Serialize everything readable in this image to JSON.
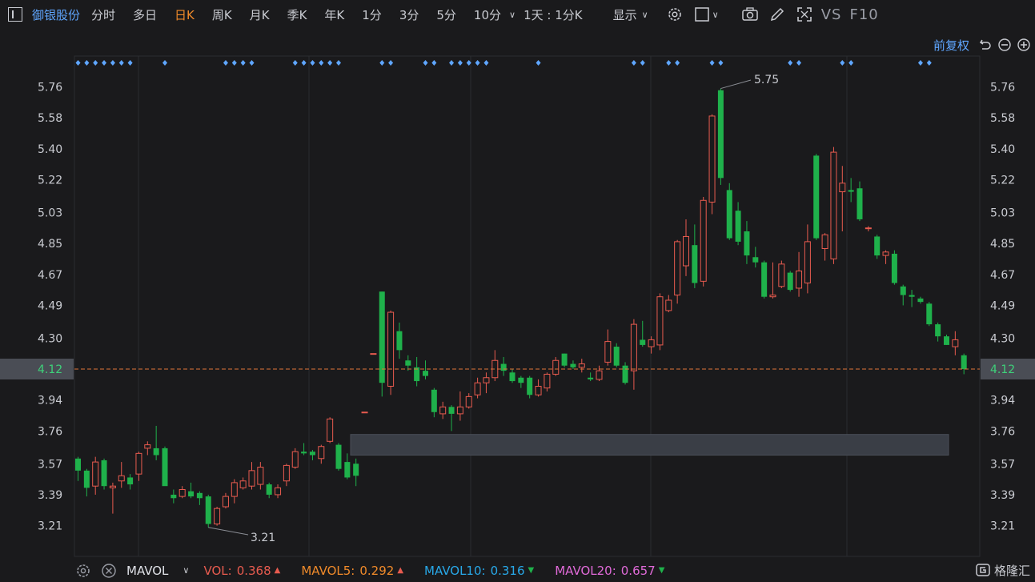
{
  "toolbar": {
    "stock_name": "御银股份",
    "tabs": [
      "分时",
      "多日",
      "日K",
      "周K",
      "月K",
      "季K",
      "年K",
      "1分",
      "3分",
      "5分",
      "10分"
    ],
    "active_tab": "日K",
    "minute_setting": "1天 : 1分K",
    "display_label": "显示",
    "vs_label": "VS",
    "f10_label": "F10"
  },
  "sub_toolbar": {
    "adjust_label": "前复权"
  },
  "bottom": {
    "indicator": "MAVOL",
    "vol_label": "VOL:",
    "vol_value": "0.368",
    "mavol5_label": "MAVOL5:",
    "mavol5_value": "0.292",
    "mavol10_label": "MAVOL10:",
    "mavol10_value": "0.316",
    "mavol20_label": "MAVOL20:",
    "mavol20_value": "0.657",
    "logo": "格隆汇"
  },
  "colors": {
    "up": "#e85b4f",
    "down": "#1fb14b",
    "accent": "#5fa6ff",
    "active_tab": "#f08a2a",
    "mavol5": "#f08a2a",
    "mavol10": "#28a8e8",
    "mavol20": "#e06ad8"
  },
  "chart_data": {
    "type": "candlestick",
    "y_ticks": [
      "5.76",
      "5.58",
      "5.40",
      "5.22",
      "5.03",
      "4.85",
      "4.67",
      "4.49",
      "4.30",
      "4.12",
      "3.94",
      "3.76",
      "3.57",
      "3.39",
      "3.21"
    ],
    "current_price": "4.12",
    "high_label": "5.75",
    "low_label": "3.21",
    "annotation_box": {
      "y_low": 3.62,
      "y_high": 3.74
    },
    "candles": [
      {
        "o": 3.6,
        "h": 3.61,
        "l": 3.47,
        "c": 3.53
      },
      {
        "o": 3.53,
        "h": 3.54,
        "l": 3.38,
        "c": 3.43
      },
      {
        "o": 3.44,
        "h": 3.61,
        "l": 3.39,
        "c": 3.58
      },
      {
        "o": 3.59,
        "h": 3.6,
        "l": 3.42,
        "c": 3.44
      },
      {
        "o": 3.43,
        "h": 3.46,
        "l": 3.28,
        "c": 3.44
      },
      {
        "o": 3.47,
        "h": 3.58,
        "l": 3.43,
        "c": 3.5
      },
      {
        "o": 3.49,
        "h": 3.51,
        "l": 3.42,
        "c": 3.45
      },
      {
        "o": 3.51,
        "h": 3.64,
        "l": 3.47,
        "c": 3.63
      },
      {
        "o": 3.66,
        "h": 3.7,
        "l": 3.62,
        "c": 3.68
      },
      {
        "o": 3.66,
        "h": 3.79,
        "l": 3.59,
        "c": 3.62
      },
      {
        "o": 3.66,
        "h": 3.67,
        "l": 3.45,
        "c": 3.44
      },
      {
        "o": 3.39,
        "h": 3.42,
        "l": 3.34,
        "c": 3.37
      },
      {
        "o": 3.38,
        "h": 3.44,
        "l": 3.37,
        "c": 3.42
      },
      {
        "o": 3.41,
        "h": 3.46,
        "l": 3.37,
        "c": 3.38
      },
      {
        "o": 3.4,
        "h": 3.41,
        "l": 3.33,
        "c": 3.37
      },
      {
        "o": 3.38,
        "h": 3.39,
        "l": 3.2,
        "c": 3.22
      },
      {
        "o": 3.22,
        "h": 3.32,
        "l": 3.21,
        "c": 3.31
      },
      {
        "o": 3.32,
        "h": 3.4,
        "l": 3.31,
        "c": 3.38
      },
      {
        "o": 3.38,
        "h": 3.48,
        "l": 3.34,
        "c": 3.46
      },
      {
        "o": 3.43,
        "h": 3.49,
        "l": 3.42,
        "c": 3.47
      },
      {
        "o": 3.44,
        "h": 3.58,
        "l": 3.42,
        "c": 3.53
      },
      {
        "o": 3.45,
        "h": 3.58,
        "l": 3.42,
        "c": 3.55
      },
      {
        "o": 3.45,
        "h": 3.46,
        "l": 3.37,
        "c": 3.39
      },
      {
        "o": 3.39,
        "h": 3.45,
        "l": 3.37,
        "c": 3.43
      },
      {
        "o": 3.47,
        "h": 3.57,
        "l": 3.44,
        "c": 3.56
      },
      {
        "o": 3.55,
        "h": 3.66,
        "l": 3.54,
        "c": 3.64
      },
      {
        "o": 3.64,
        "h": 3.69,
        "l": 3.62,
        "c": 3.63
      },
      {
        "o": 3.64,
        "h": 3.65,
        "l": 3.59,
        "c": 3.62
      },
      {
        "o": 3.6,
        "h": 3.68,
        "l": 3.57,
        "c": 3.67
      },
      {
        "o": 3.7,
        "h": 3.84,
        "l": 3.69,
        "c": 3.83
      },
      {
        "o": 3.68,
        "h": 3.69,
        "l": 3.53,
        "c": 3.54
      },
      {
        "o": 3.58,
        "h": 3.63,
        "l": 3.48,
        "c": 3.49
      },
      {
        "o": 3.57,
        "h": 3.6,
        "l": 3.44,
        "c": 3.5
      },
      {
        "o": 3.87,
        "h": 3.87,
        "l": 3.87,
        "c": 3.87
      },
      {
        "o": 4.21,
        "h": 4.21,
        "l": 4.21,
        "c": 4.21
      },
      {
        "o": 4.57,
        "h": 4.57,
        "l": 3.96,
        "c": 4.04
      },
      {
        "o": 4.02,
        "h": 4.46,
        "l": 3.97,
        "c": 4.45
      },
      {
        "o": 4.34,
        "h": 4.39,
        "l": 4.18,
        "c": 4.23
      },
      {
        "o": 4.17,
        "h": 4.2,
        "l": 4.11,
        "c": 4.14
      },
      {
        "o": 4.13,
        "h": 4.19,
        "l": 4.02,
        "c": 4.05
      },
      {
        "o": 4.11,
        "h": 4.17,
        "l": 4.06,
        "c": 4.08
      },
      {
        "o": 4.0,
        "h": 4.01,
        "l": 3.84,
        "c": 3.87
      },
      {
        "o": 3.86,
        "h": 3.93,
        "l": 3.83,
        "c": 3.9
      },
      {
        "o": 3.9,
        "h": 3.91,
        "l": 3.76,
        "c": 3.86
      },
      {
        "o": 3.86,
        "h": 3.99,
        "l": 3.82,
        "c": 3.9
      },
      {
        "o": 3.9,
        "h": 3.98,
        "l": 3.89,
        "c": 3.96
      },
      {
        "o": 3.97,
        "h": 4.07,
        "l": 3.95,
        "c": 4.04
      },
      {
        "o": 4.04,
        "h": 4.1,
        "l": 3.98,
        "c": 4.07
      },
      {
        "o": 4.07,
        "h": 4.23,
        "l": 4.05,
        "c": 4.17
      },
      {
        "o": 4.15,
        "h": 4.19,
        "l": 4.08,
        "c": 4.11
      },
      {
        "o": 4.1,
        "h": 4.12,
        "l": 4.04,
        "c": 4.05
      },
      {
        "o": 4.07,
        "h": 4.08,
        "l": 4.01,
        "c": 4.04
      },
      {
        "o": 4.07,
        "h": 4.08,
        "l": 3.95,
        "c": 3.97
      },
      {
        "o": 3.97,
        "h": 4.06,
        "l": 3.96,
        "c": 4.02
      },
      {
        "o": 4.01,
        "h": 4.1,
        "l": 3.99,
        "c": 4.09
      },
      {
        "o": 4.09,
        "h": 4.19,
        "l": 4.08,
        "c": 4.17
      },
      {
        "o": 4.21,
        "h": 4.21,
        "l": 4.13,
        "c": 4.14
      },
      {
        "o": 4.15,
        "h": 4.17,
        "l": 4.12,
        "c": 4.13
      },
      {
        "o": 4.13,
        "h": 4.18,
        "l": 4.1,
        "c": 4.15
      },
      {
        "o": 4.07,
        "h": 4.1,
        "l": 4.05,
        "c": 4.06
      },
      {
        "o": 4.06,
        "h": 4.14,
        "l": 4.05,
        "c": 4.11
      },
      {
        "o": 4.16,
        "h": 4.35,
        "l": 4.14,
        "c": 4.28
      },
      {
        "o": 4.25,
        "h": 4.27,
        "l": 4.13,
        "c": 4.14
      },
      {
        "o": 4.14,
        "h": 4.16,
        "l": 4.03,
        "c": 4.04
      },
      {
        "o": 4.11,
        "h": 4.41,
        "l": 4.0,
        "c": 4.38
      },
      {
        "o": 4.29,
        "h": 4.4,
        "l": 4.25,
        "c": 4.26
      },
      {
        "o": 4.25,
        "h": 4.31,
        "l": 4.21,
        "c": 4.29
      },
      {
        "o": 4.26,
        "h": 4.56,
        "l": 4.23,
        "c": 4.54
      },
      {
        "o": 4.46,
        "h": 4.55,
        "l": 4.45,
        "c": 4.52
      },
      {
        "o": 4.55,
        "h": 4.87,
        "l": 4.5,
        "c": 4.86
      },
      {
        "o": 4.72,
        "h": 4.99,
        "l": 4.66,
        "c": 4.89
      },
      {
        "o": 4.84,
        "h": 4.96,
        "l": 4.59,
        "c": 4.62
      },
      {
        "o": 4.63,
        "h": 5.12,
        "l": 4.6,
        "c": 5.1
      },
      {
        "o": 5.09,
        "h": 5.6,
        "l": 5.02,
        "c": 5.59
      },
      {
        "o": 5.74,
        "h": 5.75,
        "l": 5.19,
        "c": 5.23
      },
      {
        "o": 5.16,
        "h": 5.2,
        "l": 4.87,
        "c": 4.88
      },
      {
        "o": 5.04,
        "h": 5.09,
        "l": 4.84,
        "c": 4.86
      },
      {
        "o": 4.92,
        "h": 4.98,
        "l": 4.73,
        "c": 4.78
      },
      {
        "o": 4.77,
        "h": 4.83,
        "l": 4.71,
        "c": 4.74
      },
      {
        "o": 4.74,
        "h": 4.75,
        "l": 4.53,
        "c": 4.54
      },
      {
        "o": 4.54,
        "h": 4.74,
        "l": 4.53,
        "c": 4.55
      },
      {
        "o": 4.6,
        "h": 4.75,
        "l": 4.59,
        "c": 4.73
      },
      {
        "o": 4.68,
        "h": 4.69,
        "l": 4.57,
        "c": 4.58
      },
      {
        "o": 4.59,
        "h": 4.8,
        "l": 4.54,
        "c": 4.69
      },
      {
        "o": 4.62,
        "h": 4.96,
        "l": 4.56,
        "c": 4.86
      },
      {
        "o": 5.36,
        "h": 5.37,
        "l": 4.87,
        "c": 4.88
      },
      {
        "o": 4.82,
        "h": 4.91,
        "l": 4.75,
        "c": 4.9
      },
      {
        "o": 4.76,
        "h": 5.41,
        "l": 4.73,
        "c": 5.38
      },
      {
        "o": 5.15,
        "h": 5.3,
        "l": 4.92,
        "c": 5.2
      },
      {
        "o": 5.16,
        "h": 5.23,
        "l": 5.09,
        "c": 5.15
      },
      {
        "o": 5.17,
        "h": 5.21,
        "l": 4.98,
        "c": 4.99
      },
      {
        "o": 4.94,
        "h": 4.95,
        "l": 4.92,
        "c": 4.94
      },
      {
        "o": 4.89,
        "h": 4.9,
        "l": 4.76,
        "c": 4.78
      },
      {
        "o": 4.78,
        "h": 4.81,
        "l": 4.73,
        "c": 4.8
      },
      {
        "o": 4.79,
        "h": 4.81,
        "l": 4.61,
        "c": 4.62
      },
      {
        "o": 4.6,
        "h": 4.61,
        "l": 4.49,
        "c": 4.55
      },
      {
        "o": 4.55,
        "h": 4.58,
        "l": 4.48,
        "c": 4.54
      },
      {
        "o": 4.53,
        "h": 4.54,
        "l": 4.5,
        "c": 4.51
      },
      {
        "o": 4.5,
        "h": 4.51,
        "l": 4.37,
        "c": 4.38
      },
      {
        "o": 4.38,
        "h": 4.39,
        "l": 4.28,
        "c": 4.31
      },
      {
        "o": 4.31,
        "h": 4.32,
        "l": 4.26,
        "c": 4.26
      },
      {
        "o": 4.25,
        "h": 4.34,
        "l": 4.2,
        "c": 4.29
      },
      {
        "o": 4.2,
        "h": 4.21,
        "l": 4.09,
        "c": 4.12
      }
    ],
    "markers": [
      0,
      1,
      2,
      3,
      4,
      5,
      6,
      10,
      17,
      18,
      19,
      20,
      25,
      26,
      27,
      28,
      29,
      30,
      35,
      36,
      40,
      41,
      43,
      44,
      45,
      46,
      47,
      53,
      64,
      65,
      68,
      69,
      73,
      74,
      82,
      83,
      88,
      89,
      97,
      98
    ]
  }
}
